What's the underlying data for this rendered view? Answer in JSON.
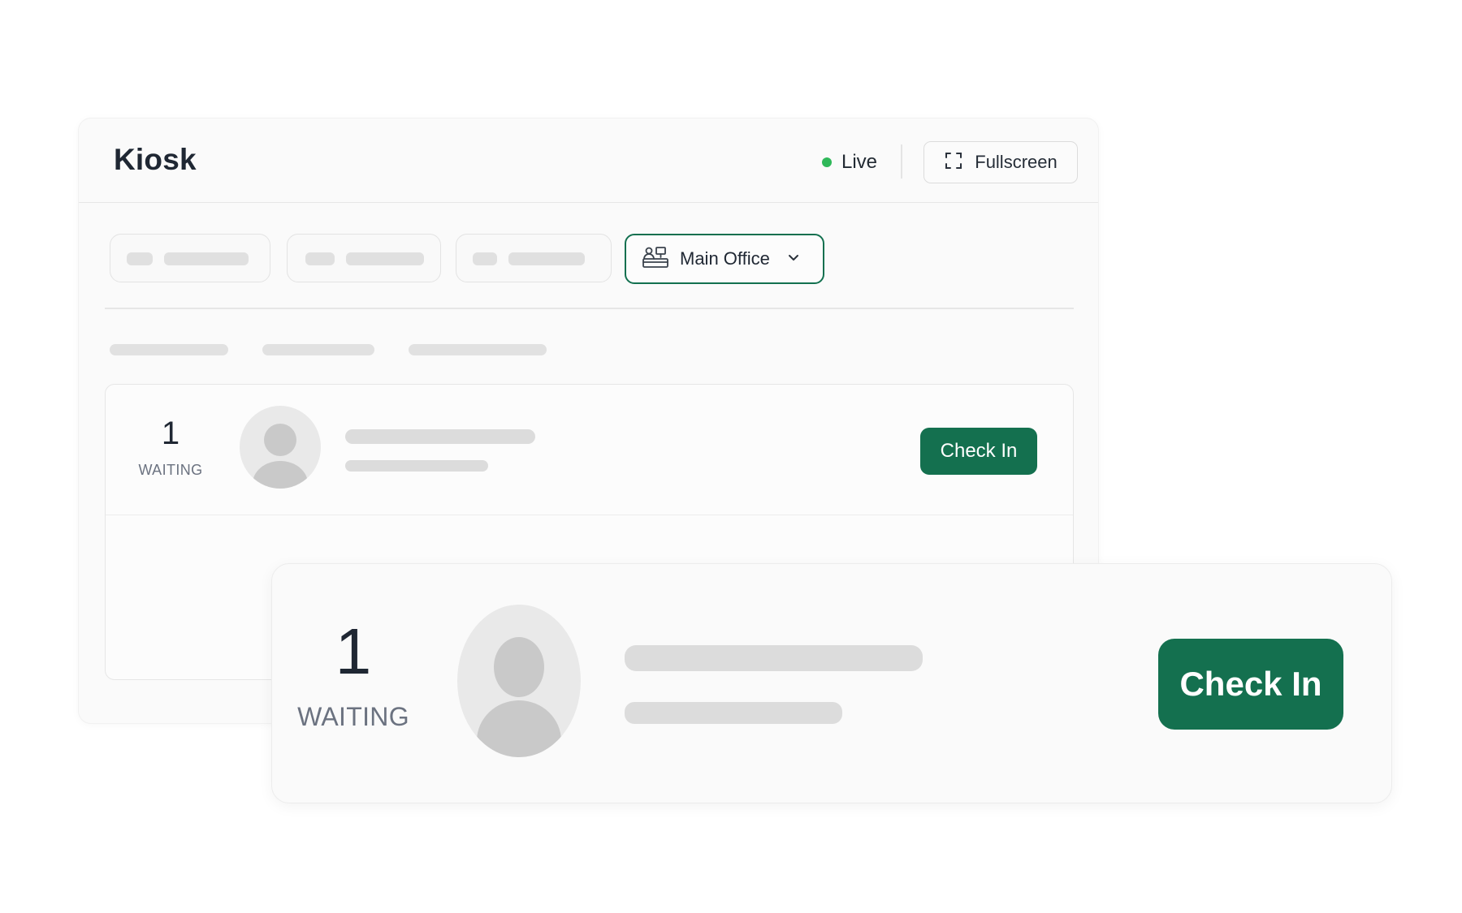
{
  "kiosk": {
    "title": "Kiosk",
    "live_label": "Live",
    "fullscreen_label": "Fullscreen",
    "location_label": "Main Office",
    "queue": {
      "count": "1",
      "status": "WAITING",
      "action_label": "Check In"
    }
  },
  "zoom_card": {
    "count": "1",
    "status": "WAITING",
    "action_label": "Check In"
  },
  "colors": {
    "accent": "#14704f",
    "live": "#2fb859",
    "skeleton": "#dcdcdc"
  }
}
